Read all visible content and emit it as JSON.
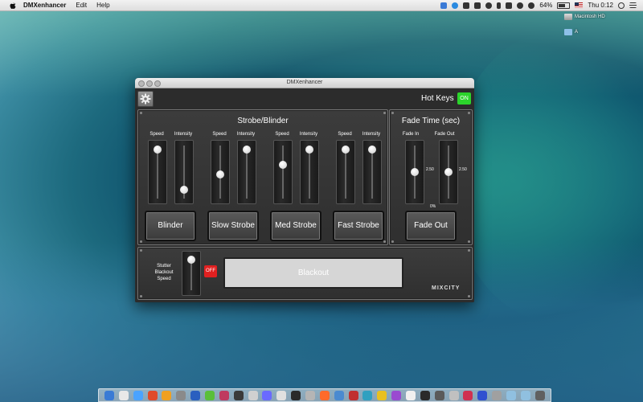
{
  "menubar": {
    "app_name": "DMXenhancer",
    "menus": [
      "Edit",
      "Help"
    ],
    "battery": "64%",
    "clock": "Thu 0:12"
  },
  "desktop": {
    "icons": [
      {
        "label": "Macintosh HD"
      },
      {
        "label": "A"
      }
    ]
  },
  "window": {
    "title": "DMXenhancer",
    "hot_keys_label": "Hot Keys",
    "hot_keys_state": "ON",
    "strobe_panel": {
      "title": "Strobe/Blinder",
      "groups": [
        {
          "speed_label": "Speed",
          "intensity_label": "Intensity",
          "speed_level": 0.95,
          "intensity_level": 0.15,
          "button": "Blinder"
        },
        {
          "speed_label": "Speed",
          "intensity_label": "Intensity",
          "speed_level": 0.45,
          "intensity_level": 0.95,
          "button": "Slow Strobe"
        },
        {
          "speed_label": "Speed",
          "intensity_label": "Intensity",
          "speed_level": 0.65,
          "intensity_level": 0.95,
          "button": "Med Strobe"
        },
        {
          "speed_label": "Speed",
          "intensity_label": "Intensity",
          "speed_level": 0.95,
          "intensity_level": 0.95,
          "button": "Fast Strobe"
        }
      ]
    },
    "fade_panel": {
      "title": "Fade Time (sec)",
      "fade_in_label": "Fade In",
      "fade_out_label": "Fade Out",
      "fade_in_value": "2.50",
      "fade_out_value": "2.50",
      "fade_in_level": 0.5,
      "fade_out_level": 0.5,
      "percent_label": "0%",
      "button": "Fade Out"
    },
    "bottom_panel": {
      "stutter_label_1": "Stutter",
      "stutter_label_2": "Blackout",
      "stutter_label_3": "Speed",
      "stutter_level": 0.95,
      "off_label": "OFF",
      "blackout_label": "Blackout",
      "logo": "MIXCITY"
    }
  },
  "colors": {
    "on_green": "#2bd42b",
    "off_red": "#e02020",
    "panel_bg": "#2c2c2c"
  }
}
